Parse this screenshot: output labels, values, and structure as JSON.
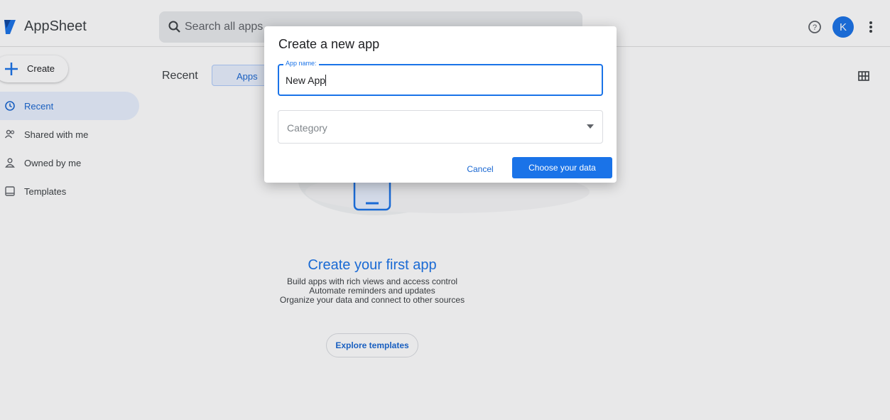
{
  "header": {
    "brand": "AppSheet",
    "search_placeholder": "Search all apps",
    "avatar_initial": "K"
  },
  "sidebar": {
    "create_label": "Create",
    "items": [
      {
        "label": "Recent",
        "icon": "clock-icon",
        "active": true
      },
      {
        "label": "Shared with me",
        "icon": "people-icon",
        "active": false
      },
      {
        "label": "Owned by me",
        "icon": "person-icon",
        "active": false
      },
      {
        "label": "Templates",
        "icon": "template-icon",
        "active": false
      }
    ]
  },
  "main": {
    "title": "Recent",
    "tab_apps": "Apps",
    "empty": {
      "title": "Create your first app",
      "lines": [
        "Build apps with rich views and access control",
        "Automate reminders and updates",
        "Organize your data and connect to other sources"
      ],
      "explore_label": "Explore templates"
    }
  },
  "dialog": {
    "title": "Create a new app",
    "app_name_label": "App name:",
    "app_name_value": "New App",
    "category_placeholder": "Category",
    "cancel_label": "Cancel",
    "choose_label": "Choose your data"
  },
  "colors": {
    "accent": "#1a73e8",
    "active_bg": "#e8f0fe"
  }
}
